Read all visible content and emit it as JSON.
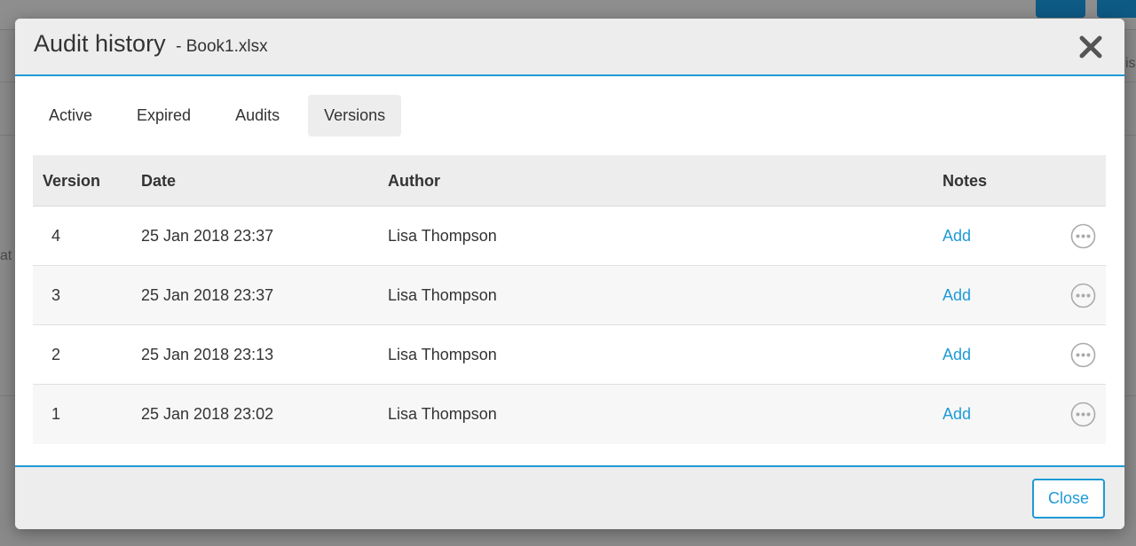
{
  "modal": {
    "title": "Audit history",
    "subtitle": "- Book1.xlsx",
    "close_icon": "close-icon"
  },
  "tabs": [
    {
      "label": "Active",
      "active": false
    },
    {
      "label": "Expired",
      "active": false
    },
    {
      "label": "Audits",
      "active": false
    },
    {
      "label": "Versions",
      "active": true
    }
  ],
  "table": {
    "columns": [
      "Version",
      "Date",
      "Author",
      "Notes"
    ],
    "rows": [
      {
        "version": "4",
        "date": "25 Jan 2018 23:37",
        "author": "Lisa Thompson",
        "notes": "Add"
      },
      {
        "version": "3",
        "date": "25 Jan 2018 23:37",
        "author": "Lisa Thompson",
        "notes": "Add"
      },
      {
        "version": "2",
        "date": "25 Jan 2018 23:13",
        "author": "Lisa Thompson",
        "notes": "Add"
      },
      {
        "version": "1",
        "date": "25 Jan 2018 23:02",
        "author": "Lisa Thompson",
        "notes": "Add"
      }
    ],
    "row_action_icon": "more-options-icon"
  },
  "footer": {
    "close_label": "Close"
  },
  "background": {
    "partial_left_text": "at",
    "partial_right_text": "is"
  },
  "colors": {
    "accent": "#1e9ad6",
    "header_bg": "#ededed",
    "overlay": "#8a8a8a"
  }
}
